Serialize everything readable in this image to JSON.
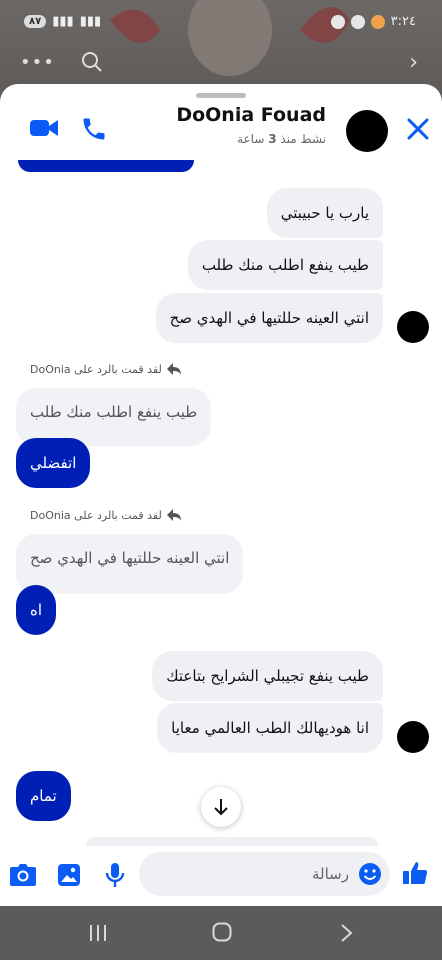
{
  "status": {
    "time": "٣:٢٤",
    "battery": "٨٧"
  },
  "header": {
    "name": "DoOnia Fouad",
    "active_prefix": "نشط منذ",
    "active_num": "3",
    "active_suffix": "ساعة"
  },
  "messages": {
    "m1": "يارب يا حبيبتي",
    "m2": "طيب ينفع اطلب منك طلب",
    "m3": "انتي العينه حللتيها في الهدي صح",
    "reply1_note": "لقد قمت بالرد على DoOnia",
    "reply1_quote": "طيب ينفع اطلب منك طلب",
    "reply1_msg": "اتفضلي",
    "reply2_note": "لقد قمت بالرد على DoOnia",
    "reply2_quote": "انتي العينه حللتيها في الهدي صح",
    "reply2_msg": "اه",
    "m4": "طيب ينفع تجيبلي الشرايح بتاعتك",
    "m5": "انا هوديهالك الطب العالمي معايا",
    "m6": "تمام"
  },
  "composer": {
    "placeholder": "رسالة"
  },
  "colors": {
    "accent": "#0020b5",
    "icon_blue": "#0a5cf5"
  }
}
